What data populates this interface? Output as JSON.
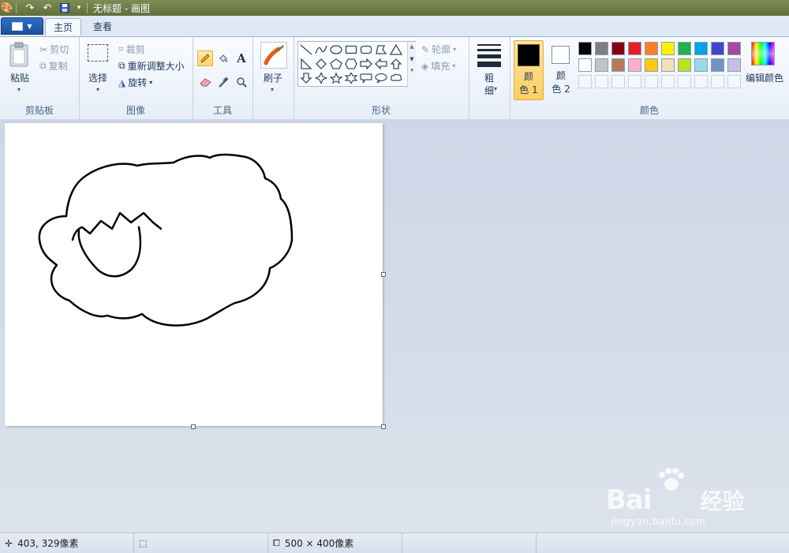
{
  "window": {
    "title": "无标题 - 画图"
  },
  "tabs": [
    {
      "label": "主页",
      "active": true
    },
    {
      "label": "查看",
      "active": false
    }
  ],
  "ribbon": {
    "clipboard": {
      "group_label": "剪贴板",
      "paste_label": "粘贴",
      "cut_label": "剪切",
      "copy_label": "复制"
    },
    "image": {
      "group_label": "图像",
      "select_label": "选择",
      "crop_label": "裁剪",
      "resize_label": "重新调整大小",
      "rotate_label": "旋转"
    },
    "tools": {
      "group_label": "工具",
      "text_tool_glyph": "A",
      "active_tool": "pencil"
    },
    "brushes": {
      "label": "刷子"
    },
    "shapes": {
      "group_label": "形状",
      "outline_label": "轮廓",
      "fill_label": "填充"
    },
    "size": {
      "label_line1": "粗",
      "label_line2": "细"
    },
    "colors": {
      "group_label": "颜色",
      "color1_line1": "颜",
      "color1_line2": "色 1",
      "color2_line1": "颜",
      "color2_line2": "色 2",
      "color1_value": "#000000",
      "color2_value": "#ffffff",
      "edit_label": "编辑颜色",
      "palette_row1": [
        "#000000",
        "#7f7f7f",
        "#880015",
        "#ed1c24",
        "#ff7f27",
        "#fff200",
        "#22b14c",
        "#00a2e8",
        "#3f48cc",
        "#a349a4"
      ],
      "palette_row2": [
        "#ffffff",
        "#c3c3c3",
        "#b97a57",
        "#ffaec9",
        "#ffc90e",
        "#efe4b0",
        "#b5e61d",
        "#99d9ea",
        "#7092be",
        "#c8bfe7"
      ]
    }
  },
  "status": {
    "cursor_position": "403, 329像素",
    "selection_size": "",
    "canvas_size": "500 × 400像素"
  },
  "watermark": {
    "brand": "Bai",
    "brand_tail": "经验",
    "url": "jingyan.baidu.com"
  }
}
